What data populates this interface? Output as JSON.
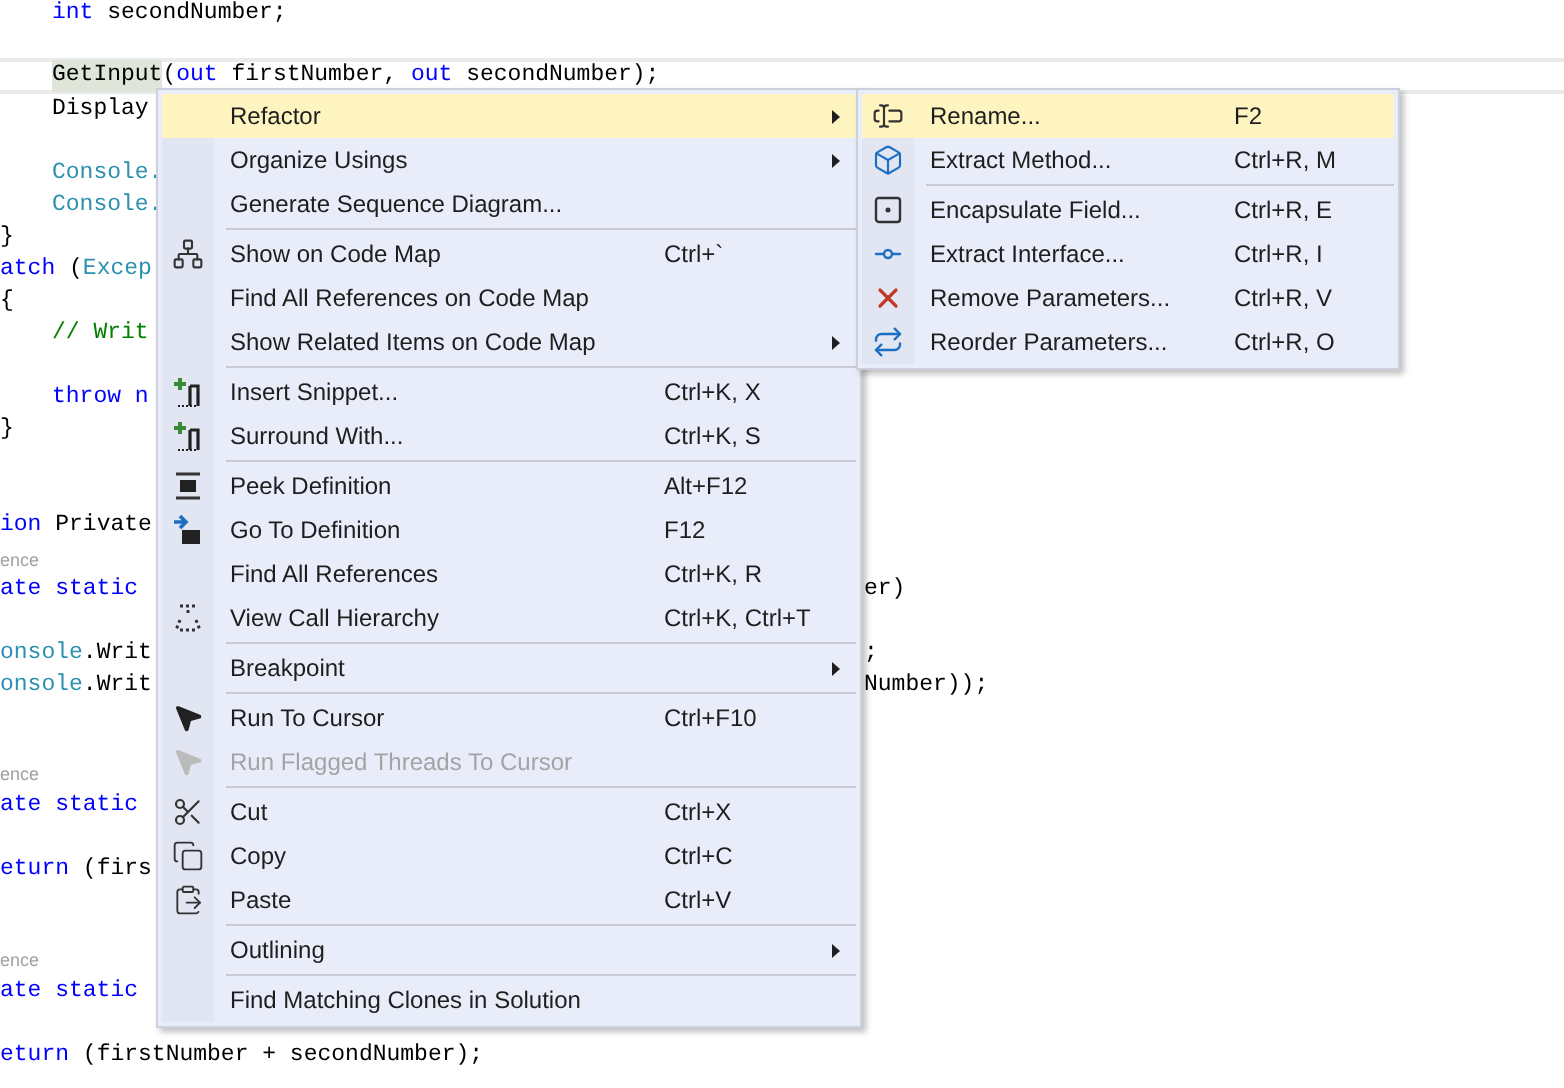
{
  "code_lines": [
    {
      "left": [
        {
          "text": "int",
          "kind": "keyword"
        },
        {
          "text": " secondNumber;",
          "kind": "plain"
        }
      ]
    },
    {
      "current": true,
      "left": [
        {
          "text": "GetInput",
          "kind": "plain",
          "highlighted": true
        },
        {
          "text": "(",
          "kind": "plain"
        },
        {
          "text": "out",
          "kind": "keyword"
        },
        {
          "text": " firstNumber, ",
          "kind": "plain"
        },
        {
          "text": "out",
          "kind": "keyword"
        },
        {
          "text": " secondNumber);",
          "kind": "plain"
        }
      ]
    },
    {
      "left": [
        {
          "text": "Display",
          "kind": "plain"
        }
      ]
    },
    {
      "left": [
        {
          "text": "Console.",
          "kind": "type"
        }
      ]
    },
    {
      "left": [
        {
          "text": "Console.",
          "kind": "type"
        }
      ]
    },
    {
      "left": [
        {
          "text": "}",
          "kind": "plain"
        }
      ]
    },
    {
      "left": [
        {
          "text": "atch",
          "kind": "keyword"
        },
        {
          "text": " (",
          "kind": "plain"
        },
        {
          "text": "Excep",
          "kind": "type"
        }
      ]
    },
    {
      "left": [
        {
          "text": "{",
          "kind": "plain"
        }
      ]
    },
    {
      "left": [
        {
          "text": "// Writ",
          "kind": "comment"
        }
      ]
    },
    {
      "left": [
        {
          "text": "throw n",
          "kind": "keyword"
        }
      ]
    },
    {
      "left": [
        {
          "text": "}",
          "kind": "plain"
        }
      ]
    },
    {
      "left": [
        {
          "text": "ion",
          "kind": "keyword"
        },
        {
          "text": " Private",
          "kind": "plain"
        }
      ]
    },
    {
      "left": [
        {
          "text": "ence",
          "kind": "codelens"
        }
      ]
    },
    {
      "left": [
        {
          "text": "ate static",
          "kind": "keyword"
        }
      ],
      "right": [
        {
          "text": "er)",
          "kind": "plain"
        }
      ]
    },
    {
      "left": [
        {
          "text": "onsole",
          "kind": "type"
        },
        {
          "text": ".Writ",
          "kind": "plain"
        }
      ],
      "right": [
        {
          "text": ";",
          "kind": "plain"
        }
      ]
    },
    {
      "left": [
        {
          "text": "onsole",
          "kind": "type"
        },
        {
          "text": ".Writ",
          "kind": "plain"
        }
      ],
      "right": [
        {
          "text": "Number));",
          "kind": "plain"
        }
      ]
    },
    {
      "left": [
        {
          "text": "ence",
          "kind": "codelens"
        }
      ]
    },
    {
      "left": [
        {
          "text": "ate static",
          "kind": "keyword"
        }
      ]
    },
    {
      "left": [
        {
          "text": "eturn",
          "kind": "keyword"
        },
        {
          "text": " (firs",
          "kind": "plain"
        }
      ]
    },
    {
      "left": [
        {
          "text": "ence",
          "kind": "codelens"
        }
      ]
    },
    {
      "left": [
        {
          "text": "ate static",
          "kind": "keyword"
        }
      ]
    },
    {
      "left": [
        {
          "text": "eturn",
          "kind": "keyword"
        },
        {
          "text": " (firstNumber + secondNumber);",
          "kind": "plain"
        }
      ]
    }
  ],
  "context_menu": {
    "items": [
      {
        "kind": "item",
        "label": "Refactor",
        "submenu": true,
        "selected": true,
        "disabled": false
      },
      {
        "kind": "item",
        "label": "Organize Usings",
        "submenu": true,
        "selected": false,
        "disabled": false
      },
      {
        "kind": "item",
        "label": "Generate Sequence Diagram...",
        "submenu": false,
        "selected": false,
        "disabled": false
      },
      {
        "kind": "separator"
      },
      {
        "kind": "item",
        "label": "Show on Code Map",
        "shortcut": "Ctrl+`",
        "submenu": false,
        "selected": false,
        "disabled": false
      },
      {
        "kind": "item",
        "label": "Find All References on Code Map",
        "submenu": false,
        "selected": false,
        "disabled": false
      },
      {
        "kind": "item",
        "label": "Show Related Items on Code Map",
        "submenu": true,
        "selected": false,
        "disabled": false
      },
      {
        "kind": "separator"
      },
      {
        "kind": "item",
        "label": "Insert Snippet...",
        "shortcut": "Ctrl+K, X",
        "submenu": false,
        "selected": false,
        "disabled": false
      },
      {
        "kind": "item",
        "label": "Surround With...",
        "shortcut": "Ctrl+K, S",
        "submenu": false,
        "selected": false,
        "disabled": false
      },
      {
        "kind": "separator"
      },
      {
        "kind": "item",
        "label": "Peek Definition",
        "shortcut": "Alt+F12",
        "submenu": false,
        "selected": false,
        "disabled": false
      },
      {
        "kind": "item",
        "label": "Go To Definition",
        "shortcut": "F12",
        "submenu": false,
        "selected": false,
        "disabled": false
      },
      {
        "kind": "item",
        "label": "Find All References",
        "shortcut": "Ctrl+K, R",
        "submenu": false,
        "selected": false,
        "disabled": false
      },
      {
        "kind": "item",
        "label": "View Call Hierarchy",
        "shortcut": "Ctrl+K, Ctrl+T",
        "submenu": false,
        "selected": false,
        "disabled": false
      },
      {
        "kind": "separator"
      },
      {
        "kind": "item",
        "label": "Breakpoint",
        "submenu": true,
        "selected": false,
        "disabled": false
      },
      {
        "kind": "separator"
      },
      {
        "kind": "item",
        "label": "Run To Cursor",
        "shortcut": "Ctrl+F10",
        "submenu": false,
        "selected": false,
        "disabled": false
      },
      {
        "kind": "item",
        "label": "Run Flagged Threads To Cursor",
        "submenu": false,
        "selected": false,
        "disabled": true
      },
      {
        "kind": "separator"
      },
      {
        "kind": "item",
        "label": "Cut",
        "shortcut": "Ctrl+X",
        "submenu": false,
        "selected": false,
        "disabled": false
      },
      {
        "kind": "item",
        "label": "Copy",
        "shortcut": "Ctrl+C",
        "submenu": false,
        "selected": false,
        "disabled": false
      },
      {
        "kind": "item",
        "label": "Paste",
        "shortcut": "Ctrl+V",
        "submenu": false,
        "selected": false,
        "disabled": false
      },
      {
        "kind": "separator"
      },
      {
        "kind": "item",
        "label": "Outlining",
        "submenu": true,
        "selected": false,
        "disabled": false
      },
      {
        "kind": "separator"
      },
      {
        "kind": "item",
        "label": "Find Matching Clones in Solution",
        "submenu": false,
        "selected": false,
        "disabled": false
      }
    ]
  },
  "refactor_submenu": {
    "items": [
      {
        "kind": "item",
        "label": "Rename...",
        "shortcut": "F2",
        "selected": true
      },
      {
        "kind": "item",
        "label": "Extract Method...",
        "shortcut": "Ctrl+R, M",
        "selected": false
      },
      {
        "kind": "separator"
      },
      {
        "kind": "item",
        "label": "Encapsulate Field...",
        "shortcut": "Ctrl+R, E",
        "selected": false
      },
      {
        "kind": "item",
        "label": "Extract Interface...",
        "shortcut": "Ctrl+R, I",
        "selected": false
      },
      {
        "kind": "item",
        "label": "Remove Parameters...",
        "shortcut": "Ctrl+R, V",
        "selected": false
      },
      {
        "kind": "item",
        "label": "Reorder Parameters...",
        "shortcut": "Ctrl+R, O",
        "selected": false
      }
    ]
  }
}
